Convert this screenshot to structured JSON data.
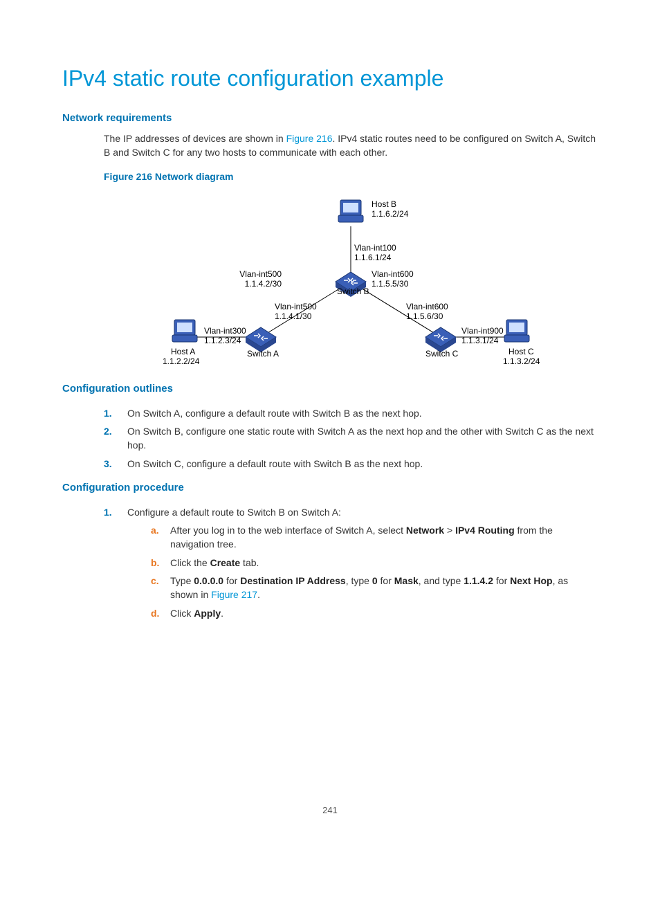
{
  "title": "IPv4 static route configuration example",
  "sec1": {
    "heading": "Network requirements",
    "para_a": "The IP addresses of devices are shown in ",
    "link": "Figure 216",
    "para_b": ". IPv4 static routes need to be configured on Switch A, Switch B and Switch C for any two hosts to communicate with each other.",
    "figcap": "Figure 216 Network diagram"
  },
  "diagram": {
    "hostA": "Host A",
    "hostA_ip": "1.1.2.2/24",
    "hostB": "Host B",
    "hostB_ip": "1.1.6.2/24",
    "hostC": "Host C",
    "hostC_ip": "1.1.3.2/24",
    "swA": "Switch A",
    "swB": "Switch B",
    "swC": "Switch C",
    "vlan100": "Vlan-int100",
    "vlan100_ip": "1.1.6.1/24",
    "vlan500_b": "Vlan-int500",
    "vlan500_b_ip": "1.1.4.2/30",
    "vlan600_b": "Vlan-int600",
    "vlan600_b_ip": "1.1.5.5/30",
    "vlan500_a": "Vlan-int500",
    "vlan500_a_ip": "1.1.4.1/30",
    "vlan600_c": "Vlan-int600",
    "vlan600_c_ip": "1.1.5.6/30",
    "vlan300": "Vlan-int300",
    "vlan300_ip": "1.1.2.3/24",
    "vlan900": "Vlan-int900",
    "vlan900_ip": "1.1.3.1/24"
  },
  "sec2": {
    "heading": "Configuration outlines",
    "items": [
      "On Switch A, configure a default route with Switch B as the next hop.",
      "On Switch B, configure one static route with Switch A as the next hop and the other with Switch C as the next hop.",
      "On Switch C, configure a default route with Switch B as the next hop."
    ]
  },
  "sec3": {
    "heading": "Configuration procedure",
    "step1": "Configure a default route to Switch B on Switch A:",
    "a_pre": "After you log in to the web interface of Switch A, select ",
    "a_b1": "Network",
    "a_gt": " > ",
    "a_b2": "IPv4 Routing",
    "a_post": " from the navigation tree.",
    "b_pre": "Click the ",
    "b_b": "Create",
    "b_post": " tab.",
    "c_pre": "Type ",
    "c_b1": "0.0.0.0",
    "c_mid1": " for ",
    "c_b2": "Destination IP Address",
    "c_mid2": ", type ",
    "c_b3": "0",
    "c_mid3": " for ",
    "c_b4": "Mask",
    "c_mid4": ", and type ",
    "c_b5": "1.1.4.2",
    "c_mid5": " for ",
    "c_b6": "Next Hop",
    "c_mid6": ", as shown in ",
    "c_link": "Figure 217",
    "c_end": ".",
    "d_pre": "Click ",
    "d_b": "Apply",
    "d_post": "."
  },
  "page": "241"
}
